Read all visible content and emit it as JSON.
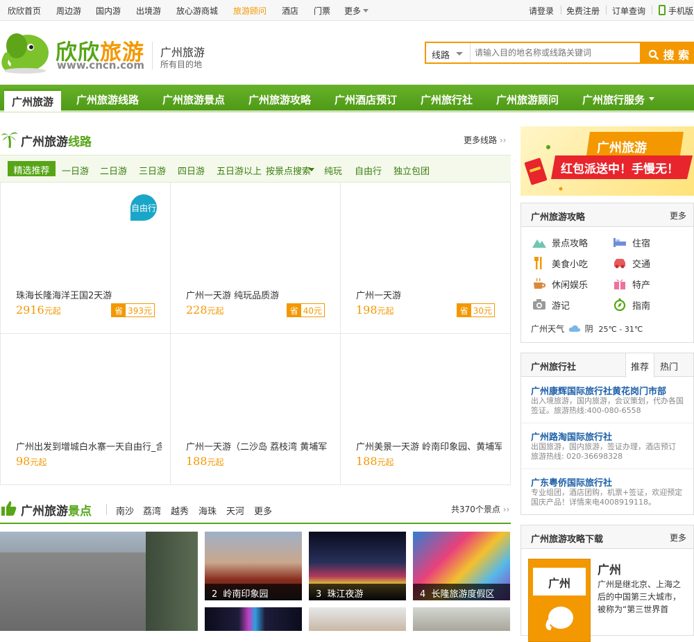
{
  "topbar": {
    "left_links": [
      "欣欣首页",
      "周边游",
      "国内游",
      "出境游",
      "放心游商城",
      "旅游顾问",
      "酒店",
      "门票",
      "更多"
    ],
    "right_links": [
      "请登录",
      "免费注册",
      "订单查询",
      "手机版"
    ]
  },
  "header": {
    "logo_text_a": "欣欣",
    "logo_text_b": "旅游",
    "logo_url": "www.cncn.com",
    "city_title": "广州旅游",
    "city_subtitle": "所有目的地",
    "search_type": "线路",
    "search_placeholder": "请输入目的地名称或线路关键词",
    "search_button": "搜 索"
  },
  "nav": [
    "广州旅游",
    "广州旅游线路",
    "广州旅游景点",
    "广州旅游攻略",
    "广州酒店预订",
    "广州旅行社",
    "广州旅游顾问",
    "广州旅行服务"
  ],
  "routes": {
    "title_a": "广州旅游",
    "title_b": "线路",
    "more": "更多线路",
    "tabs": [
      "精选推荐",
      "一日游",
      "二日游",
      "三日游",
      "四日游",
      "五日游以上",
      "按景点搜索",
      "纯玩",
      "自由行",
      "独立包团"
    ],
    "badge": "自由行",
    "save_label": "省",
    "price_unit": "元起",
    "cards": [
      {
        "name": "珠海长隆海洋王国2天游",
        "price": "2916",
        "save": "393元"
      },
      {
        "name": "广州一天游 纯玩品质游",
        "price": "228",
        "save": "40元"
      },
      {
        "name": "广州一天游",
        "price": "198",
        "save": "30元"
      },
      {
        "name": "广州出发到增城白水寨一天自由行_含",
        "price": "98",
        "save": ""
      },
      {
        "name": "广州一天游（二沙岛 荔枝湾 黄埔军",
        "price": "188",
        "save": ""
      },
      {
        "name": "广州美景一天游 岭南印象园、黄埔军",
        "price": "188",
        "save": ""
      }
    ]
  },
  "spots": {
    "title_a": "广州旅游",
    "title_b": "景点",
    "tabs": [
      "南沙",
      "荔湾",
      "越秀",
      "海珠",
      "天河",
      "更多"
    ],
    "count": "共370个景点",
    "items": [
      {
        "num": "2",
        "name": "岭南印象园"
      },
      {
        "num": "3",
        "name": "珠江夜游"
      },
      {
        "num": "4",
        "name": "长隆旅游度假区"
      }
    ]
  },
  "promo": {
    "line1": "广州旅游",
    "line2": "红包派送中！手慢无！"
  },
  "guide": {
    "title": "广州旅游攻略",
    "more": "更多",
    "items": [
      "景点攻略",
      "住宿",
      "美食小吃",
      "交通",
      "休闲娱乐",
      "特产",
      "游记",
      "指南"
    ],
    "weather_label": "广州天气",
    "weather_state": "阴",
    "weather_temp": "25℃ - 31℃"
  },
  "agencies": {
    "title": "广州旅行社",
    "tab_recommend": "推荐",
    "tab_hot": "热门",
    "list": [
      {
        "name": "广州康辉国际旅行社黄花岗门市部",
        "desc": "出入境旅游，国内旅游，会议策划，代办各国签证。旅游热线:400-080-6558"
      },
      {
        "name": "广州路淘国际旅行社",
        "desc": "出国旅游，国内旅游，签证办理，酒店预订 旅游热线: 020-36698328"
      },
      {
        "name": "广东粤侨国际旅行社",
        "desc": "专业组团，酒店团购，机票+签证，欢迎预定国庆产品！详情来电4008919118。"
      }
    ]
  },
  "download": {
    "title": "广州旅游攻略下载",
    "more": "更多",
    "book_title": "广州",
    "city": "广州",
    "desc": "广州是继北京、上海之后的中国第三大城市，被称为“第三世界首"
  },
  "colors": {
    "green": "#56a517",
    "orange": "#f39800",
    "blue": "#1c5fa8"
  }
}
